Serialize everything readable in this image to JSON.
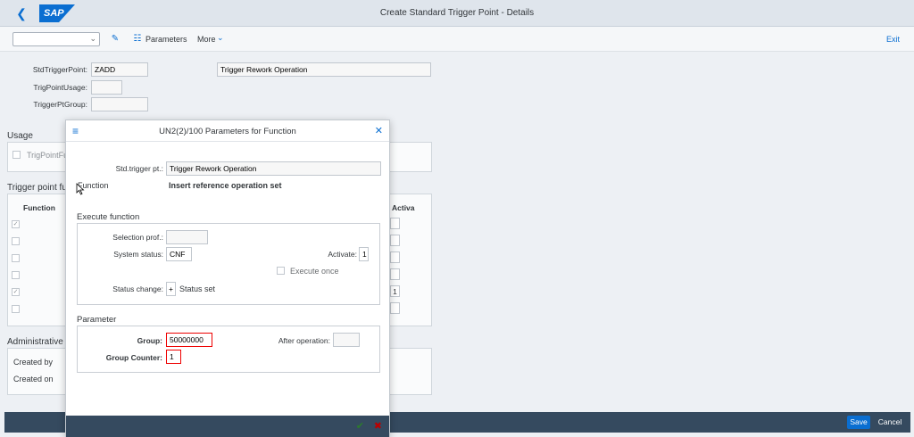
{
  "shell": {
    "title": "Create Standard Trigger Point - Details",
    "logo": "SAP",
    "back_icon": "back-icon"
  },
  "toolbar": {
    "select_value": "",
    "parameters": "Parameters",
    "more": "More",
    "exit": "Exit"
  },
  "header": {
    "std_trigger_point_label": "StdTriggerPoint:",
    "std_trigger_point_value": "ZADD",
    "description_value": "Trigger Rework Operation",
    "trig_point_usage_label": "TrigPointUsage:",
    "trigger_pt_group_label": "TriggerPtGroup:"
  },
  "usage": {
    "title": "Usage",
    "checkbox_label": "TrigPointFu"
  },
  "trigger_functions": {
    "title": "Trigger point fur",
    "col_function": "Function",
    "col_activa": "Activa",
    "rows": [
      {
        "checked": "✓",
        "activa": ""
      },
      {
        "checked": "",
        "activa": ""
      },
      {
        "checked": "",
        "activa": ""
      },
      {
        "checked": "",
        "activa": ""
      },
      {
        "checked": "✓",
        "activa": "1"
      },
      {
        "checked": "",
        "activa": ""
      }
    ]
  },
  "admin": {
    "title": "Administrative d",
    "created_by": "Created by",
    "created_on": "Created on"
  },
  "footer": {
    "save": "Save",
    "cancel": "Cancel"
  },
  "dialog": {
    "title": "UN2(2)/100 Parameters for Function",
    "std_trigger_label": "Std.trigger pt.:",
    "std_trigger_value": "Trigger Rework Operation",
    "function_label": "Function",
    "function_value": "Insert reference operation set",
    "execute_title": "Execute function",
    "selection_prof_label": "Selection prof.:",
    "selection_prof_value": "",
    "system_status_label": "System status:",
    "system_status_value": "CNF",
    "activate_label": "Activate:",
    "activate_value": "1",
    "execute_once_label": "Execute once",
    "status_change_label": "Status change:",
    "status_change_sign": "+",
    "status_change_value": "Status set",
    "parameter_title": "Parameter",
    "group_label": "Group:",
    "group_value": "50000000",
    "after_operation_label": "After operation:",
    "after_operation_value": "",
    "group_counter_label": "Group Counter:",
    "group_counter_value": "1"
  },
  "colors": {
    "accent": "#0a6ed1",
    "shell_bg": "#dfe5ec",
    "footer_bg": "#354a5f",
    "highlight": "#ee0000"
  }
}
